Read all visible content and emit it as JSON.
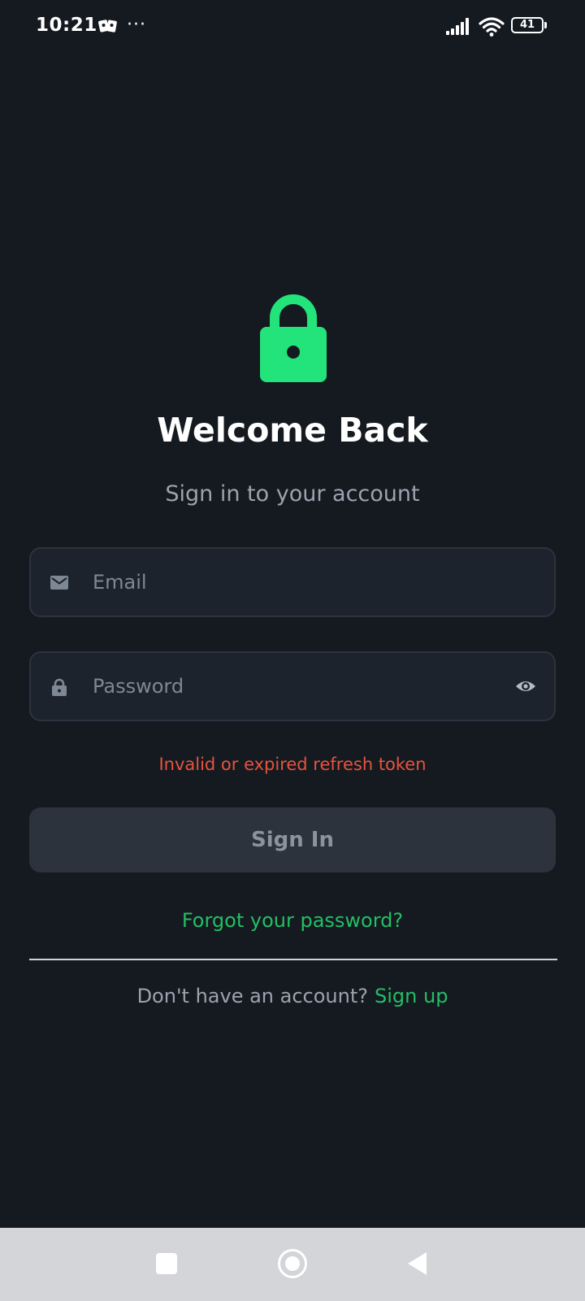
{
  "status_bar": {
    "time": "10:21",
    "more": "···",
    "battery": "41"
  },
  "login": {
    "title": "Welcome Back",
    "subtitle": "Sign in to your account",
    "email_placeholder": "Email",
    "password_placeholder": "Password",
    "error": "Invalid or expired refresh token",
    "signin_label": "Sign In",
    "forgot_password": "Forgot your password?",
    "signup_prompt": "Don't have an account?",
    "signup_link": "Sign up"
  },
  "icons": {
    "logo": "lock-icon",
    "email": "mail-icon",
    "password": "lock-icon",
    "toggle_visibility": "eye-icon",
    "nav_recent": "square-icon",
    "nav_home": "circle-icon",
    "nav_back": "triangle-back-icon"
  },
  "colors": {
    "background": "#151a21",
    "accent": "#22e47a",
    "link": "#22bf64",
    "error": "#e8533d",
    "input_background": "#1c232d",
    "button_disabled": "#2c333d"
  }
}
